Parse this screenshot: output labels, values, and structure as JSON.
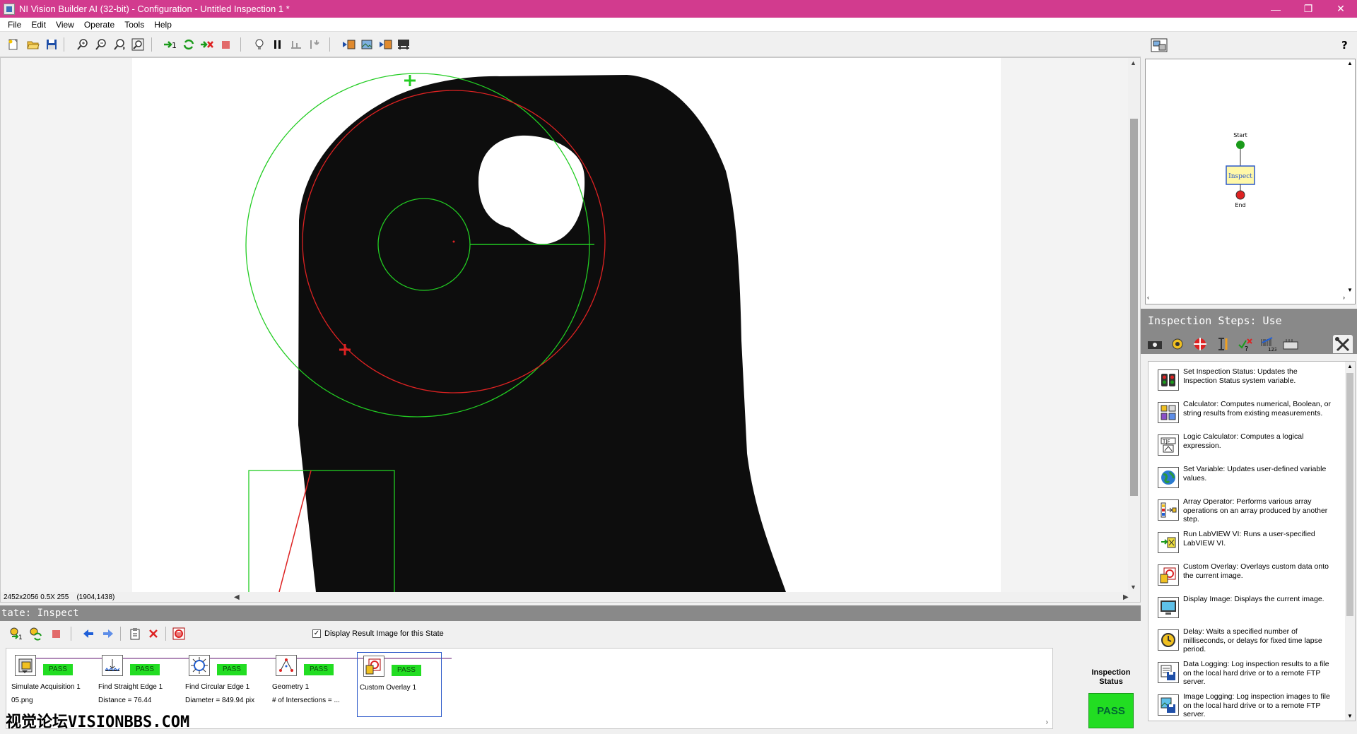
{
  "window": {
    "title": "NI Vision Builder AI (32-bit) - Configuration - Untitled Inspection 1 *",
    "minimize": "—",
    "maximize": "❐",
    "close": "✕"
  },
  "menu": [
    "File",
    "Edit",
    "View",
    "Operate",
    "Tools",
    "Help"
  ],
  "image_status": {
    "info": "2452x2056 0.5X 255",
    "coords": "(1904,1438)"
  },
  "state": {
    "header": "tate:  Inspect",
    "display_result_label": "Display Result Image for this State",
    "display_result_checked": true
  },
  "steps": [
    {
      "name": "Simulate Acquisition 1",
      "status": "PASS",
      "result": "05.png",
      "icon": "camera-icon"
    },
    {
      "name": "Find Straight Edge 1",
      "status": "PASS",
      "result": "Distance = 76.44",
      "icon": "straight-edge-icon"
    },
    {
      "name": "Find Circular Edge 1",
      "status": "PASS",
      "result": "Diameter = 849.94 pix",
      "icon": "circular-edge-icon"
    },
    {
      "name": "Geometry 1",
      "status": "PASS",
      "result": "# of Intersections = ...",
      "icon": "geometry-icon"
    },
    {
      "name": "Custom Overlay 1",
      "status": "PASS",
      "result": "",
      "icon": "custom-overlay-icon"
    }
  ],
  "watermark": "视觉论坛VISIONBBS.COM",
  "inspection_status": {
    "label": "Inspection Status",
    "value": "PASS",
    "color": "#22dd22"
  },
  "flow": {
    "start": "Start",
    "inspect": "Inspect",
    "end": "End"
  },
  "inspection_steps": {
    "title": "Inspection Steps: Use",
    "items": [
      {
        "name": "Set Inspection Status",
        "desc": "Set Inspection Status:  Updates the Inspection Status system variable.",
        "icon": "traffic-light-icon"
      },
      {
        "name": "Calculator",
        "desc": "Calculator:  Computes numerical, Boolean, or string results from existing measurements.",
        "icon": "calculator-icon"
      },
      {
        "name": "Logic Calculator",
        "desc": "Logic Calculator:  Computes a logical expression.",
        "icon": "logic-calculator-icon"
      },
      {
        "name": "Set Variable",
        "desc": "Set Variable:  Updates user-defined variable values.",
        "icon": "globe-icon"
      },
      {
        "name": "Array Operator",
        "desc": "Array Operator:  Performs various array operations on an array produced by another step.",
        "icon": "array-operator-icon"
      },
      {
        "name": "Run LabVIEW VI",
        "desc": "Run LabVIEW VI:  Runs a user-specified LabVIEW VI.",
        "icon": "labview-vi-icon"
      },
      {
        "name": "Custom Overlay",
        "desc": "Custom Overlay:  Overlays custom data onto the current image.",
        "icon": "custom-overlay-icon"
      },
      {
        "name": "Display Image",
        "desc": "Display Image:  Displays the current image.",
        "icon": "display-image-icon"
      },
      {
        "name": "Delay",
        "desc": "Delay:  Waits a specified number of milliseconds, or delays for fixed time lapse period.",
        "icon": "clock-icon"
      },
      {
        "name": "Data Logging",
        "desc": "Data Logging:  Log inspection results to a file on the local hard drive or to a remote FTP server.",
        "icon": "data-logging-icon"
      },
      {
        "name": "Image Logging",
        "desc": "Image Logging:  Log inspection images to file on the local hard drive or to a remote FTP server.",
        "icon": "image-logging-icon"
      }
    ]
  },
  "colors": {
    "titlebar": "#d23b8e",
    "pass": "#22dd22",
    "overlay_green": "#22cc22",
    "overlay_red": "#dd2222"
  }
}
